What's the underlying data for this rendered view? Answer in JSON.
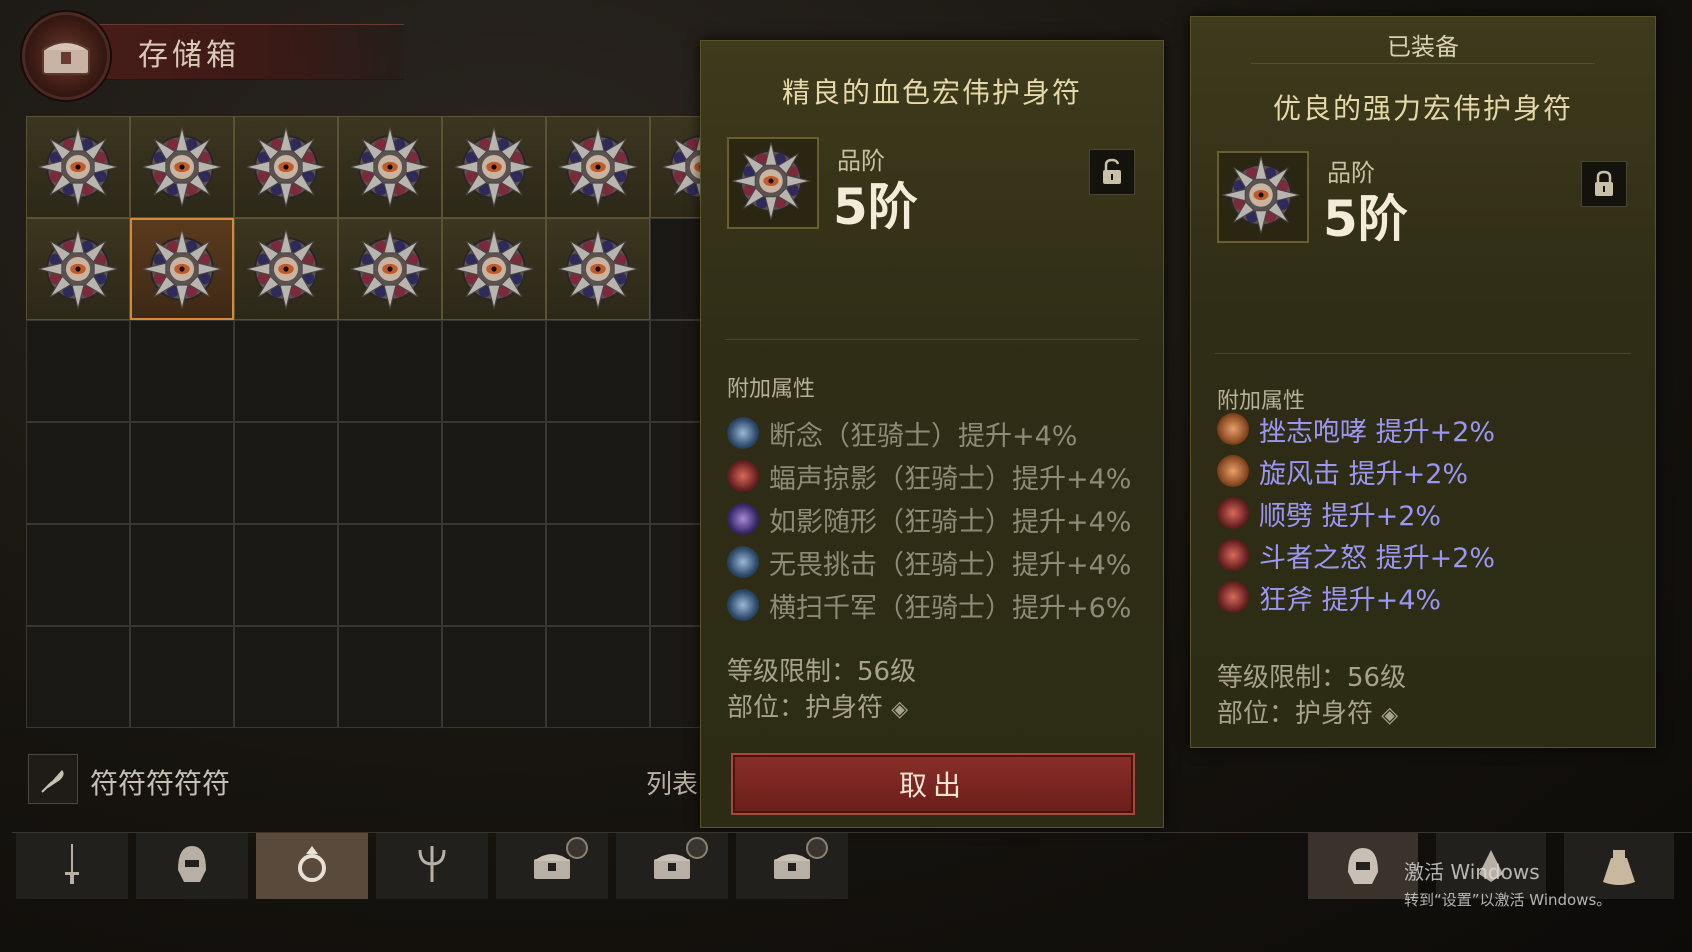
{
  "stash": {
    "title": "存储箱",
    "grid": {
      "cols": 7,
      "rows": 6,
      "filled_row1": 7,
      "filled_row2": 6,
      "selected_row": 2,
      "selected_col": 2
    },
    "filter_text": "符符符符符",
    "list_label": "列表"
  },
  "item_selected": {
    "name": "精良的血色宏伟护身符",
    "grade_label": "品阶",
    "grade_value": "5阶",
    "lock_state": "unlocked",
    "attr_header": "附加属性",
    "attributes": [
      {
        "text": "断念（狂骑士）提升+4%",
        "icon": "skill-icon-blue"
      },
      {
        "text": "蝠声掠影（狂骑士）提升+4%",
        "icon": "skill-icon-red"
      },
      {
        "text": "如影随形（狂骑士）提升+4%",
        "icon": "skill-icon-purple"
      },
      {
        "text": "无畏挑击（狂骑士）提升+4%",
        "icon": "skill-icon-blue"
      },
      {
        "text": "横扫千军（狂骑士）提升+6%",
        "icon": "skill-icon-blue"
      }
    ],
    "level_req": "等级限制：56级",
    "slot": "部位：护身符",
    "take_button": "取出"
  },
  "item_equipped": {
    "header": "已装备",
    "name": "优良的强力宏伟护身符",
    "grade_label": "品阶",
    "grade_value": "5阶",
    "lock_state": "locked",
    "attr_header": "附加属性",
    "attributes": [
      {
        "text": "挫志咆哮  提升+2%",
        "icon": "skill-icon-orange"
      },
      {
        "text": "旋风击  提升+2%",
        "icon": "skill-icon-orange"
      },
      {
        "text": "顺劈  提升+2%",
        "icon": "skill-icon-red"
      },
      {
        "text": "斗者之怒  提升+2%",
        "icon": "skill-icon-red"
      },
      {
        "text": "狂斧  提升+4%",
        "icon": "skill-icon-red"
      }
    ],
    "level_req": "等级限制：56级",
    "slot": "部位：护身符"
  },
  "tabs": [
    {
      "icon": "sword-icon"
    },
    {
      "icon": "helmet-icon"
    },
    {
      "icon": "ring-icon",
      "active": true
    },
    {
      "icon": "trident-icon"
    },
    {
      "icon": "chest-icon"
    },
    {
      "icon": "chest-icon"
    },
    {
      "icon": "chest-icon"
    }
  ],
  "watermark": {
    "line1": "激活 Windows",
    "line2": "转到“设置”以激活 Windows。"
  },
  "colors": {
    "attr_dim": "#8e8a78",
    "attr_blue": "#9a96f2",
    "selected_border": "#d48a3a",
    "button": "#8a2e28"
  }
}
